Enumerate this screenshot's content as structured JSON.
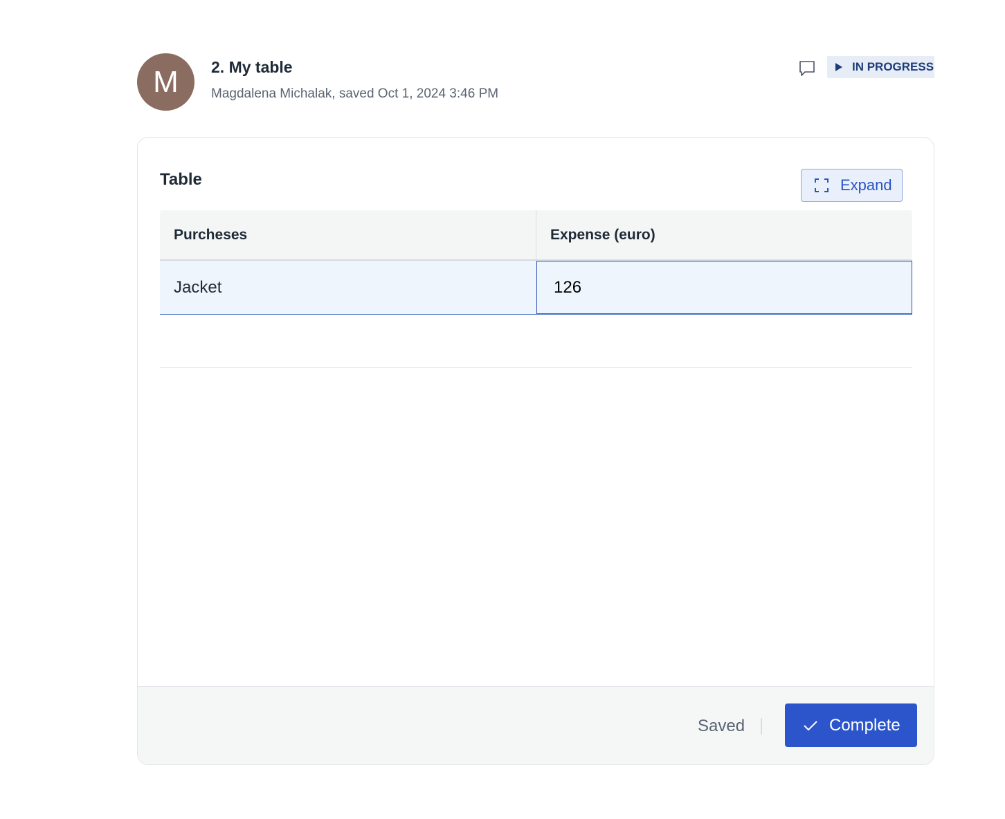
{
  "task": {
    "avatar_initial": "M",
    "title": "2. My table",
    "meta": "Magdalena Michalak, saved Oct 1, 2024 3:46 PM",
    "status": "IN PROGRESS",
    "comment_icon": "comment-icon",
    "status_icon": "play-icon"
  },
  "card": {
    "title": "Table",
    "expand_label": "Expand",
    "expand_icon": "expand-icon"
  },
  "table": {
    "columns": [
      "Purcheses",
      "Expense (euro)"
    ],
    "rows": [
      [
        "Jacket",
        "126"
      ]
    ]
  },
  "footer": {
    "saved_label": "Saved",
    "complete_label": "Complete",
    "complete_icon": "check-icon"
  },
  "colors": {
    "accent": "#2c55cb",
    "avatar": "#8a6c60",
    "badge_bg": "#e6edf7",
    "badge_text": "#1d3c78"
  }
}
